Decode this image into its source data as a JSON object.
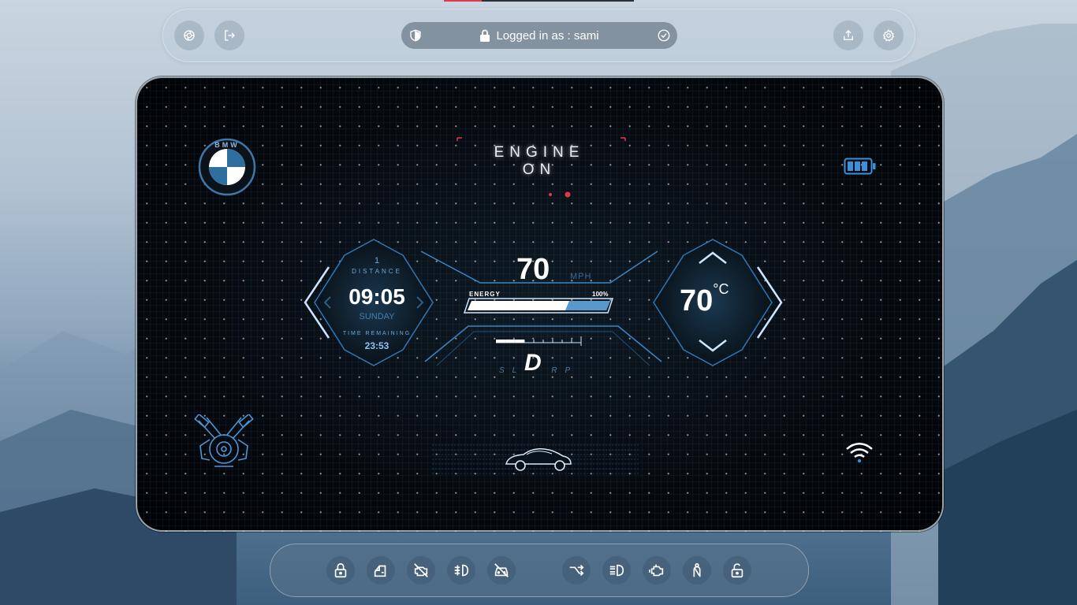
{
  "toolbar": {
    "left_buttons": [
      "camera-icon",
      "logout-icon"
    ],
    "address": {
      "text": "Logged in as : sami",
      "security": "shield-icon",
      "verified": "check-circle-icon"
    },
    "right_buttons": [
      "share-icon",
      "gear-icon"
    ]
  },
  "dashboard": {
    "brand": {
      "letters": "BMW"
    },
    "engine_status": {
      "line1": "ENGINE",
      "line2": "ON"
    },
    "left_panel": {
      "counter": "1",
      "distance_label": "DISTANCE",
      "time": "09:05",
      "day": "SUNDAY",
      "time_remaining_label": "TIME REMAINING",
      "time_remaining": "23:53"
    },
    "center_panel": {
      "speed": "70",
      "unit": "MPH",
      "energy_label": "ENERGY",
      "energy_percent": "100%",
      "energy_value": 1.0,
      "gear": "D",
      "gears": [
        "S",
        "L",
        "R",
        "P"
      ]
    },
    "right_panel": {
      "temperature": "70",
      "unit": "°C"
    },
    "battery_icon": "battery-icon",
    "wifi_icon": "wifi-icon"
  },
  "colors": {
    "accent": "#5fa8e0",
    "warning": "#e0394a",
    "panel_bg": "#05080c"
  },
  "bottom_bar": {
    "left_icons": [
      "lock-icon",
      "car-door-icon",
      "engine-off-icon",
      "fog-light-icon",
      "car-off-icon"
    ],
    "right_icons": [
      "steering-arrow-icon",
      "headlight-icon",
      "engine-warning-icon",
      "seatbelt-icon",
      "unlock-icon"
    ]
  }
}
